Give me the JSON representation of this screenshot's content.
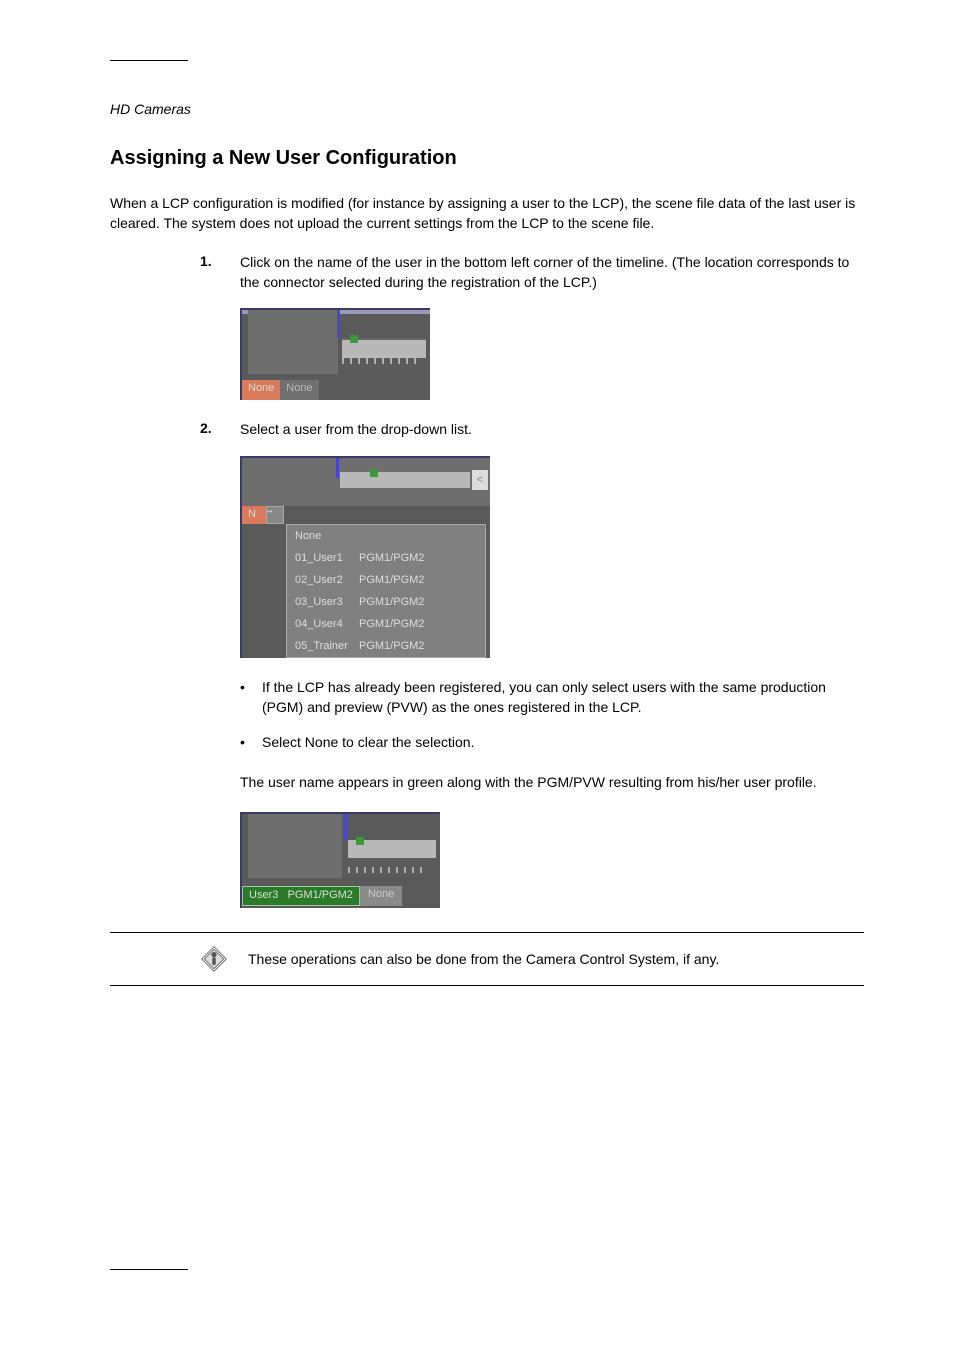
{
  "header_italic": "HD Cameras",
  "section_title": "Assigning a New User Configuration",
  "intro": "When a LCP configuration is modified (for instance by assigning a user to the LCP), the scene file data of the last user is cleared. The system does not upload the current settings from the LCP to the scene file.",
  "step1": {
    "num": "1.",
    "text": "Click on the name of the user in the bottom left corner of the timeline. (The location corresponds to the connector selected during the registration of the LCP.)"
  },
  "step2": {
    "num": "2.",
    "text": "Select a user from the drop-down list."
  },
  "shot1": {
    "none1": "None",
    "none2": "None"
  },
  "shot2": {
    "tag": "N",
    "chev": "<",
    "items": [
      {
        "c1": "None",
        "c2": ""
      },
      {
        "c1": "01_User1",
        "c2": "PGM1/PGM2"
      },
      {
        "c1": "02_User2",
        "c2": "PGM1/PGM2"
      },
      {
        "c1": "03_User3",
        "c2": "PGM1/PGM2"
      },
      {
        "c1": "04_User4",
        "c2": "PGM1/PGM2"
      },
      {
        "c1": "05_Trainer",
        "c2": "PGM1/PGM2"
      }
    ]
  },
  "bullets": [
    "If the LCP has already been registered, you can only select users with the same production (PGM) and preview (PVW) as the ones registered in the LCP.",
    "Select None to clear the selection."
  ],
  "result_text": "The user name appears in green along with the PGM/PVW resulting from his/her user profile.",
  "shot3": {
    "user": "User3",
    "pgm": "PGM1/PGM2",
    "none": "None"
  },
  "note": "These operations can also be done from the Camera Control System, if any.",
  "note_icon_label": "important-note-icon"
}
